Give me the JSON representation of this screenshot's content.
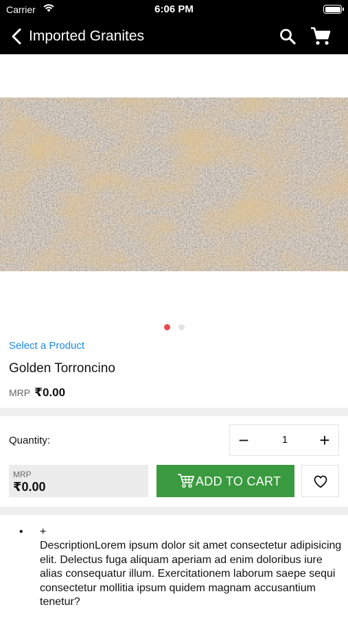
{
  "status_bar": {
    "carrier": "Carrier",
    "time": "6:06 PM"
  },
  "nav": {
    "title": "Imported Granites",
    "icons": [
      "back-chevron-icon",
      "search-icon",
      "cart-icon"
    ]
  },
  "carousel": {
    "image": "granite-slab-image",
    "page_count": 2,
    "active_index": 0,
    "active_color": "#e84a4f"
  },
  "product": {
    "select_label": "Select a Product",
    "name": "Golden Torroncino",
    "mrp_label": "MRP",
    "mrp_value": "₹0.00"
  },
  "quantity": {
    "label": "Quantity:",
    "minus": "−",
    "value": "1",
    "plus": "+"
  },
  "purchase": {
    "mrp_label": "MRP",
    "mrp_value": "₹0.00",
    "add_to_cart_label": "ADD TO CART",
    "button_color": "#3a9a3f"
  },
  "description": {
    "bullet": "•",
    "toggle": "+",
    "text": "DescriptionLorem ipsum dolor sit amet consectetur adipisicing elit. Delectus fuga aliquam aperiam ad enim doloribus iure alias consequatur illum. Exercitationem laborum saepe sequi consectetur mollitia ipsum quidem magnam accusantium tenetur?"
  },
  "colors": {
    "link": "#1e88e5",
    "header": "#000000",
    "band": "#efefef"
  }
}
